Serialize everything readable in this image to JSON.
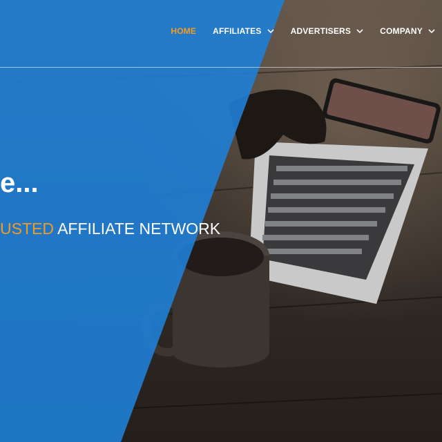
{
  "nav": {
    "items": [
      {
        "label": "HOME",
        "active": true,
        "has_dropdown": false
      },
      {
        "label": "AFFILIATES",
        "active": false,
        "has_dropdown": true
      },
      {
        "label": "ADVERTISERS",
        "active": false,
        "has_dropdown": true
      },
      {
        "label": "COMPANY",
        "active": false,
        "has_dropdown": true
      }
    ],
    "dropdown_icon": "chevron-down-icon"
  },
  "hero": {
    "headline": "e...",
    "tagline_accent": "USTED",
    "tagline_rest": " AFFILIATE NETWORK"
  },
  "colors": {
    "accent": "#f39c1f",
    "overlay_blue": "#1f7fd6",
    "text": "#ffffff"
  }
}
